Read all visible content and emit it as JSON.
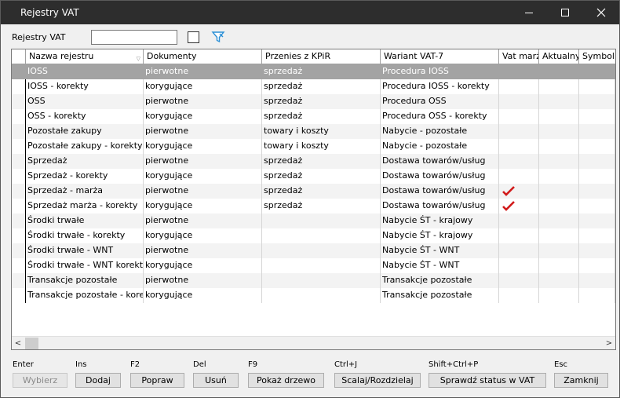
{
  "window": {
    "title": "Rejestry VAT"
  },
  "toolbar": {
    "label": "Rejestry VAT",
    "search_value": ""
  },
  "columns": [
    "Nazwa rejestru",
    "Dokumenty",
    "Przenies z KPiR",
    "Wariant VAT-7",
    "Vat marż",
    "Aktualny",
    "Symbol"
  ],
  "rows": [
    {
      "name": "IOSS",
      "docs": "pierwotne",
      "kpir": "sprzedaż",
      "variant": "Procedura IOSS",
      "vat_marza": false
    },
    {
      "name": "IOSS - korekty",
      "docs": "korygujące",
      "kpir": "sprzedaż",
      "variant": "Procedura IOSS - korekty",
      "vat_marza": false
    },
    {
      "name": "OSS",
      "docs": "pierwotne",
      "kpir": "sprzedaż",
      "variant": "Procedura OSS",
      "vat_marza": false
    },
    {
      "name": "OSS - korekty",
      "docs": "korygujące",
      "kpir": "sprzedaż",
      "variant": "Procedura OSS - korekty",
      "vat_marza": false
    },
    {
      "name": "Pozostałe zakupy",
      "docs": "pierwotne",
      "kpir": "towary i koszty",
      "variant": "Nabycie - pozostałe",
      "vat_marza": false
    },
    {
      "name": "Pozostałe zakupy - korekty",
      "docs": "korygujące",
      "kpir": "towary i koszty",
      "variant": "Nabycie - pozostałe",
      "vat_marza": false
    },
    {
      "name": "Sprzedaż",
      "docs": "pierwotne",
      "kpir": "sprzedaż",
      "variant": "Dostawa towarów/usług",
      "vat_marza": false
    },
    {
      "name": "Sprzedaż - korekty",
      "docs": "korygujące",
      "kpir": "sprzedaż",
      "variant": "Dostawa towarów/usług",
      "vat_marza": false
    },
    {
      "name": "Sprzedaż - marża",
      "docs": "pierwotne",
      "kpir": "sprzedaż",
      "variant": "Dostawa towarów/usług",
      "vat_marza": true
    },
    {
      "name": "Sprzedaż marża - korekty",
      "docs": "korygujące",
      "kpir": "sprzedaż",
      "variant": "Dostawa towarów/usług",
      "vat_marza": true
    },
    {
      "name": "Środki trwałe",
      "docs": "pierwotne",
      "kpir": "",
      "variant": "Nabycie ŚT - krajowy",
      "vat_marza": false
    },
    {
      "name": "Środki trwałe - korekty",
      "docs": "korygujące",
      "kpir": "",
      "variant": "Nabycie ŚT - krajowy",
      "vat_marza": false
    },
    {
      "name": "Środki trwałe - WNT",
      "docs": "pierwotne",
      "kpir": "",
      "variant": "Nabycie ŚT - WNT",
      "vat_marza": false
    },
    {
      "name": "Środki trwałe - WNT korekty",
      "docs": "korygujące",
      "kpir": "",
      "variant": "Nabycie ŚT - WNT",
      "vat_marza": false
    },
    {
      "name": "Transakcje pozostałe",
      "docs": "pierwotne",
      "kpir": "",
      "variant": "Transakcje pozostałe",
      "vat_marza": false
    },
    {
      "name": "Transakcje pozostałe - korekty",
      "docs": "korygujące",
      "kpir": "",
      "variant": "Transakcje pozostałe",
      "vat_marza": false
    }
  ],
  "buttons": [
    {
      "shortcut": "Enter",
      "label": "Wybierz",
      "enabled": false
    },
    {
      "shortcut": "Ins",
      "label": "Dodaj",
      "enabled": true
    },
    {
      "shortcut": "F2",
      "label": "Popraw",
      "enabled": true
    },
    {
      "shortcut": "Del",
      "label": "Usuń",
      "enabled": true
    },
    {
      "shortcut": "F9",
      "label": "Pokaż drzewo",
      "enabled": true
    },
    {
      "shortcut": "Ctrl+J",
      "label": "Scalaj/Rozdzielaj",
      "enabled": true
    },
    {
      "shortcut": "Shift+Ctrl+P",
      "label": "Sprawdź status w VAT",
      "enabled": true
    },
    {
      "shortcut": "Esc",
      "label": "Zamknij",
      "enabled": true
    }
  ],
  "colors": {
    "selected_row": "#a3a3a3",
    "check": "#d11a1a",
    "filter_icon": "#2a8fd6"
  }
}
